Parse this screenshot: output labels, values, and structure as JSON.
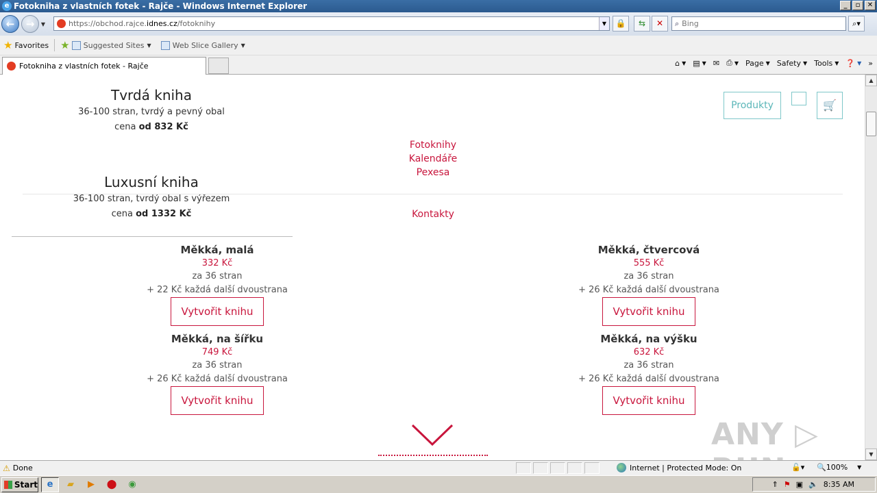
{
  "window": {
    "title": "Fotokniha z vlastních fotek - Rajče - Windows Internet Explorer",
    "buttons": [
      "_",
      "▫",
      "✕"
    ]
  },
  "nav": {
    "url_prefix": "https://obchod.rajce.",
    "url_domain": "idnes.cz",
    "url_path": "/fotoknihy",
    "search_placeholder": "Bing"
  },
  "favbar": {
    "favorites_label": "Favorites",
    "items": [
      {
        "label": "Suggested Sites"
      },
      {
        "label": "Web Slice Gallery"
      }
    ]
  },
  "tabs": {
    "active_label": "Fotokniha z vlastních fotek - Rajče"
  },
  "commandbar": {
    "page": "Page",
    "safety": "Safety",
    "tools": "Tools"
  },
  "page": {
    "books_top": [
      {
        "title": "Tvrdá kniha",
        "desc": "36-100 stran, tvrdý a pevný obal",
        "price_prefix": "cena ",
        "price": "od 832 Kč"
      },
      {
        "title": "Luxusní kniha",
        "desc": "36-100 stran, tvrdý obal s výřezem",
        "price_prefix": "cena ",
        "price": "od 1332 Kč"
      }
    ],
    "menu_links": [
      "Fotoknihy",
      "Kalendáře",
      "Pexesa",
      "Kontakty"
    ],
    "produkty_label": "Produkty",
    "cards": [
      {
        "title": "Měkká, malá",
        "price": "332 Kč",
        "pages": "za 36 stran",
        "extra": "+ 22 Kč každá další dvoustrana",
        "button": "Vytvořit knihu"
      },
      {
        "title": "Měkká, čtvercová",
        "price": "555 Kč",
        "pages": "za 36 stran",
        "extra": "+ 26 Kč každá další dvoustrana",
        "button": "Vytvořit knihu"
      },
      {
        "title": "Měkká, na šířku",
        "price": "749 Kč",
        "pages": "za 36 stran",
        "extra": "+ 26 Kč každá další dvoustrana",
        "button": "Vytvořit knihu"
      },
      {
        "title": "Měkká, na výšku",
        "price": "632 Kč",
        "pages": "za 36 stran",
        "extra": "+ 26 Kč každá další dvoustrana",
        "button": "Vytvořit knihu"
      }
    ],
    "watermark": "ANY ▷ RUN"
  },
  "status": {
    "text": "Done",
    "zone": "Internet | Protected Mode: On",
    "zoom": "100%"
  },
  "taskbar": {
    "start": "Start",
    "clock": "8:35 AM"
  },
  "colors": {
    "accent": "#c8153c",
    "teal": "#5bb6b8"
  }
}
